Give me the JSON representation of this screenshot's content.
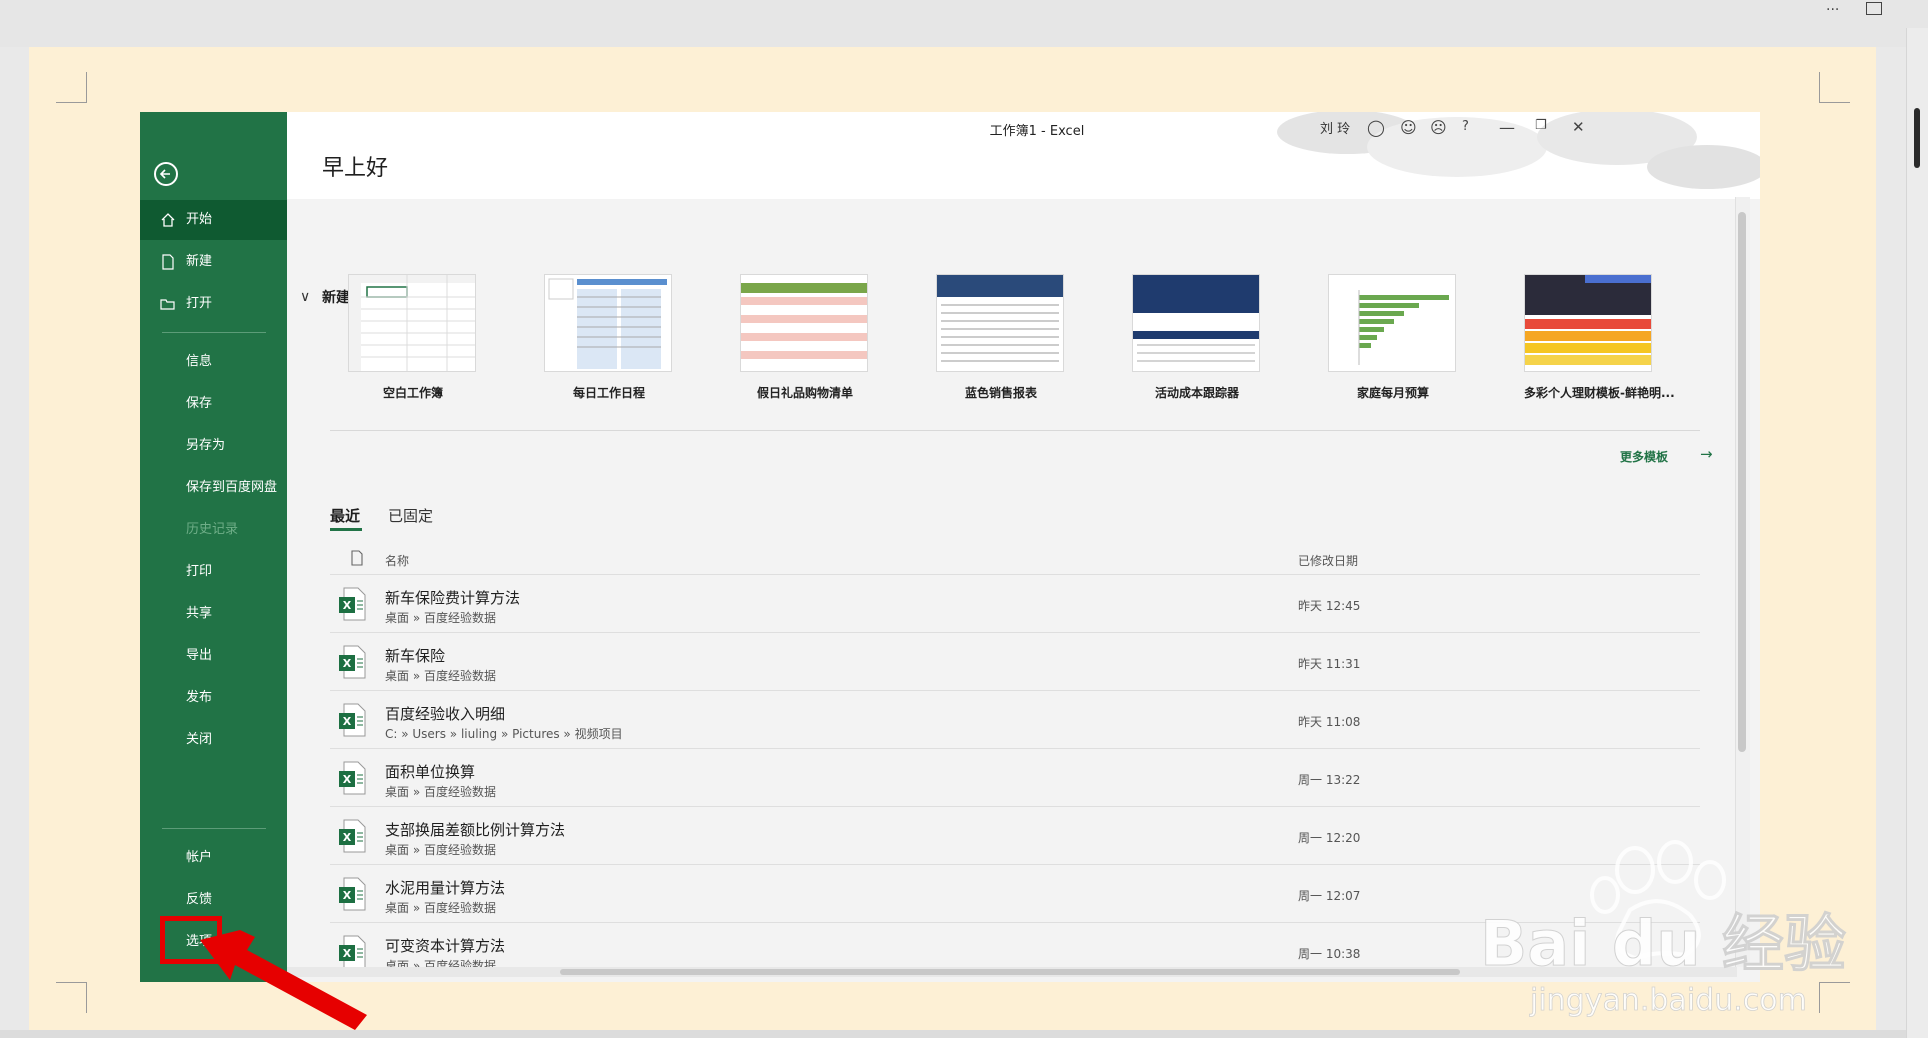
{
  "window": {
    "title": "工作簿1  -  Excel",
    "user": "刘 玲",
    "help": "?"
  },
  "greeting": "早上好",
  "sidebar": {
    "items": [
      {
        "label": "开始",
        "icon": "home-icon",
        "active": true
      },
      {
        "label": "新建",
        "icon": "new-document-icon"
      },
      {
        "label": "打开",
        "icon": "open-folder-icon"
      }
    ],
    "secondary": [
      "信息",
      "保存",
      "另存为",
      "保存到百度网盘",
      "历史记录",
      "打印",
      "共享",
      "导出",
      "发布",
      "关闭"
    ],
    "disabled_index": 4,
    "bottom": [
      "帐户",
      "反馈",
      "选项"
    ]
  },
  "new_section": {
    "title": "新建",
    "more_templates": "更多模板",
    "templates": [
      {
        "label": "空白工作簿",
        "kind": "blank"
      },
      {
        "label": "每日工作日程",
        "kind": "schedule"
      },
      {
        "label": "假日礼品购物清单",
        "kind": "shopping"
      },
      {
        "label": "蓝色销售报表",
        "kind": "sales"
      },
      {
        "label": "活动成本跟踪器",
        "kind": "cost"
      },
      {
        "label": "家庭每月预算",
        "kind": "budget"
      },
      {
        "label": "多彩个人理财模板-鲜艳明...",
        "kind": "finance"
      }
    ]
  },
  "tabs": {
    "recent": "最近",
    "pinned": "已固定"
  },
  "file_list": {
    "col_name": "名称",
    "col_date": "已修改日期",
    "files": [
      {
        "name": "新车保险费计算方法",
        "path": "桌面 » 百度经验数据",
        "date": "昨天 12:45"
      },
      {
        "name": "新车保险",
        "path": "桌面 » 百度经验数据",
        "date": "昨天 11:31"
      },
      {
        "name": "百度经验收入明细",
        "path": "C: » Users » liuling » Pictures » 视频项目",
        "date": "昨天 11:08"
      },
      {
        "name": "面积单位换算",
        "path": "桌面 » 百度经验数据",
        "date": "周一 13:22"
      },
      {
        "name": "支部换届差额比例计算方法",
        "path": "桌面 » 百度经验数据",
        "date": "周一 12:20"
      },
      {
        "name": "水泥用量计算方法",
        "path": "桌面 » 百度经验数据",
        "date": "周一 12:07"
      },
      {
        "name": "可变资本计算方法",
        "path": "桌面 » 百度经验数据",
        "date": "周一 10:38"
      }
    ]
  },
  "watermark": {
    "brand": "Bai du 经验",
    "url": "jingyan.baidu.com"
  },
  "colors": {
    "excel_green": "#217346",
    "excel_green_dark": "#0f5a31",
    "highlight_red": "#e60000",
    "paper": "#fdf0d5"
  }
}
